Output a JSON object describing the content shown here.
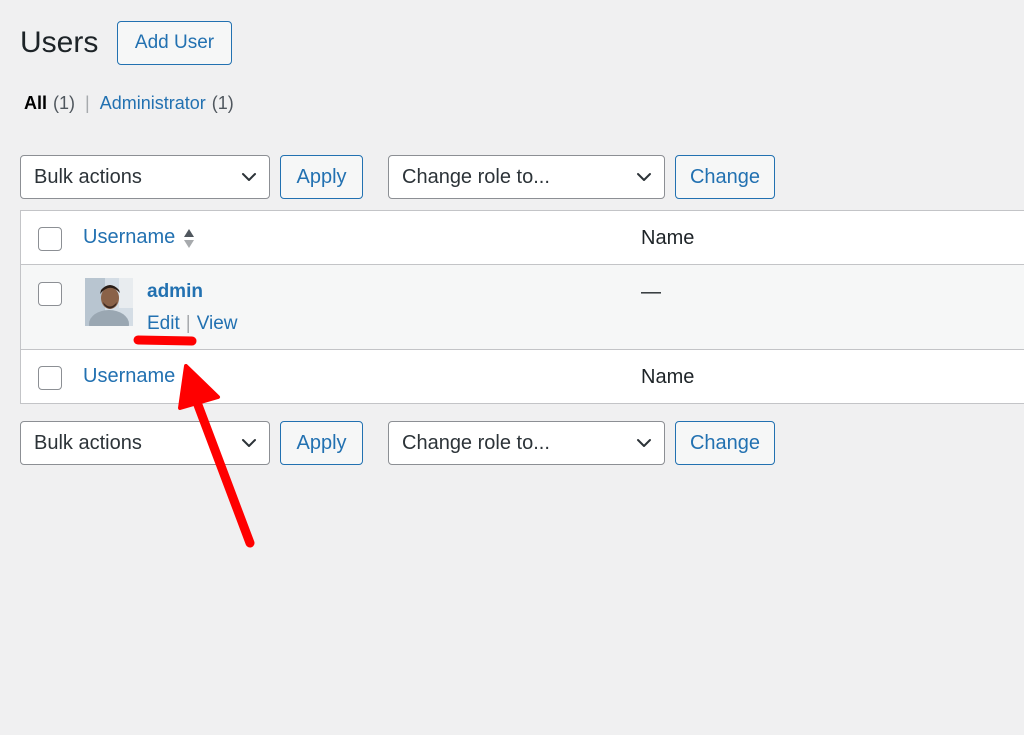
{
  "header": {
    "title": "Users",
    "add_user_label": "Add User"
  },
  "filters": {
    "all_label": "All",
    "all_count": "(1)",
    "separator": "|",
    "admin_label": "Administrator",
    "admin_count": "(1)"
  },
  "top_toolbar": {
    "bulk_actions": "Bulk actions",
    "apply": "Apply",
    "change_role": "Change role to...",
    "change": "Change"
  },
  "bottom_toolbar": {
    "bulk_actions": "Bulk actions",
    "apply": "Apply",
    "change_role": "Change role to...",
    "change": "Change"
  },
  "table": {
    "columns": {
      "username": "Username",
      "name": "Name"
    },
    "rows": [
      {
        "username": "admin",
        "name": "—",
        "actions": {
          "edit": "Edit",
          "separator": "|",
          "view": "View"
        }
      }
    ]
  },
  "colors": {
    "accent": "#2271b1",
    "annotation": "#ff0000",
    "background": "#f0f0f1"
  }
}
